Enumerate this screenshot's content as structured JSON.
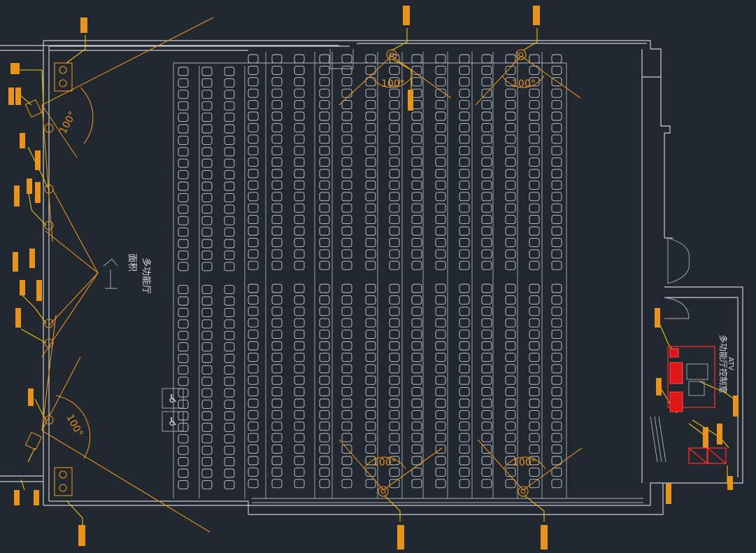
{
  "room": {
    "name": "多功能厅",
    "sub_label": "面积",
    "control_room_name": "多功能厅控制室",
    "control_room_tag": "ATV"
  },
  "angle_labels": [
    "100°",
    "100°",
    "100°",
    "100°",
    "100°",
    "100°"
  ],
  "colors": {
    "background": "#212830",
    "walls": "#c9cdd2",
    "devices": "#e8941a",
    "leaders": "#f2c200",
    "equipment_racks": "#e01515"
  },
  "icons": {
    "camera": "camera-icon",
    "speaker": "speaker-icon",
    "wheelchair": "wheelchair-icon",
    "rack": "equipment-rack-icon"
  }
}
